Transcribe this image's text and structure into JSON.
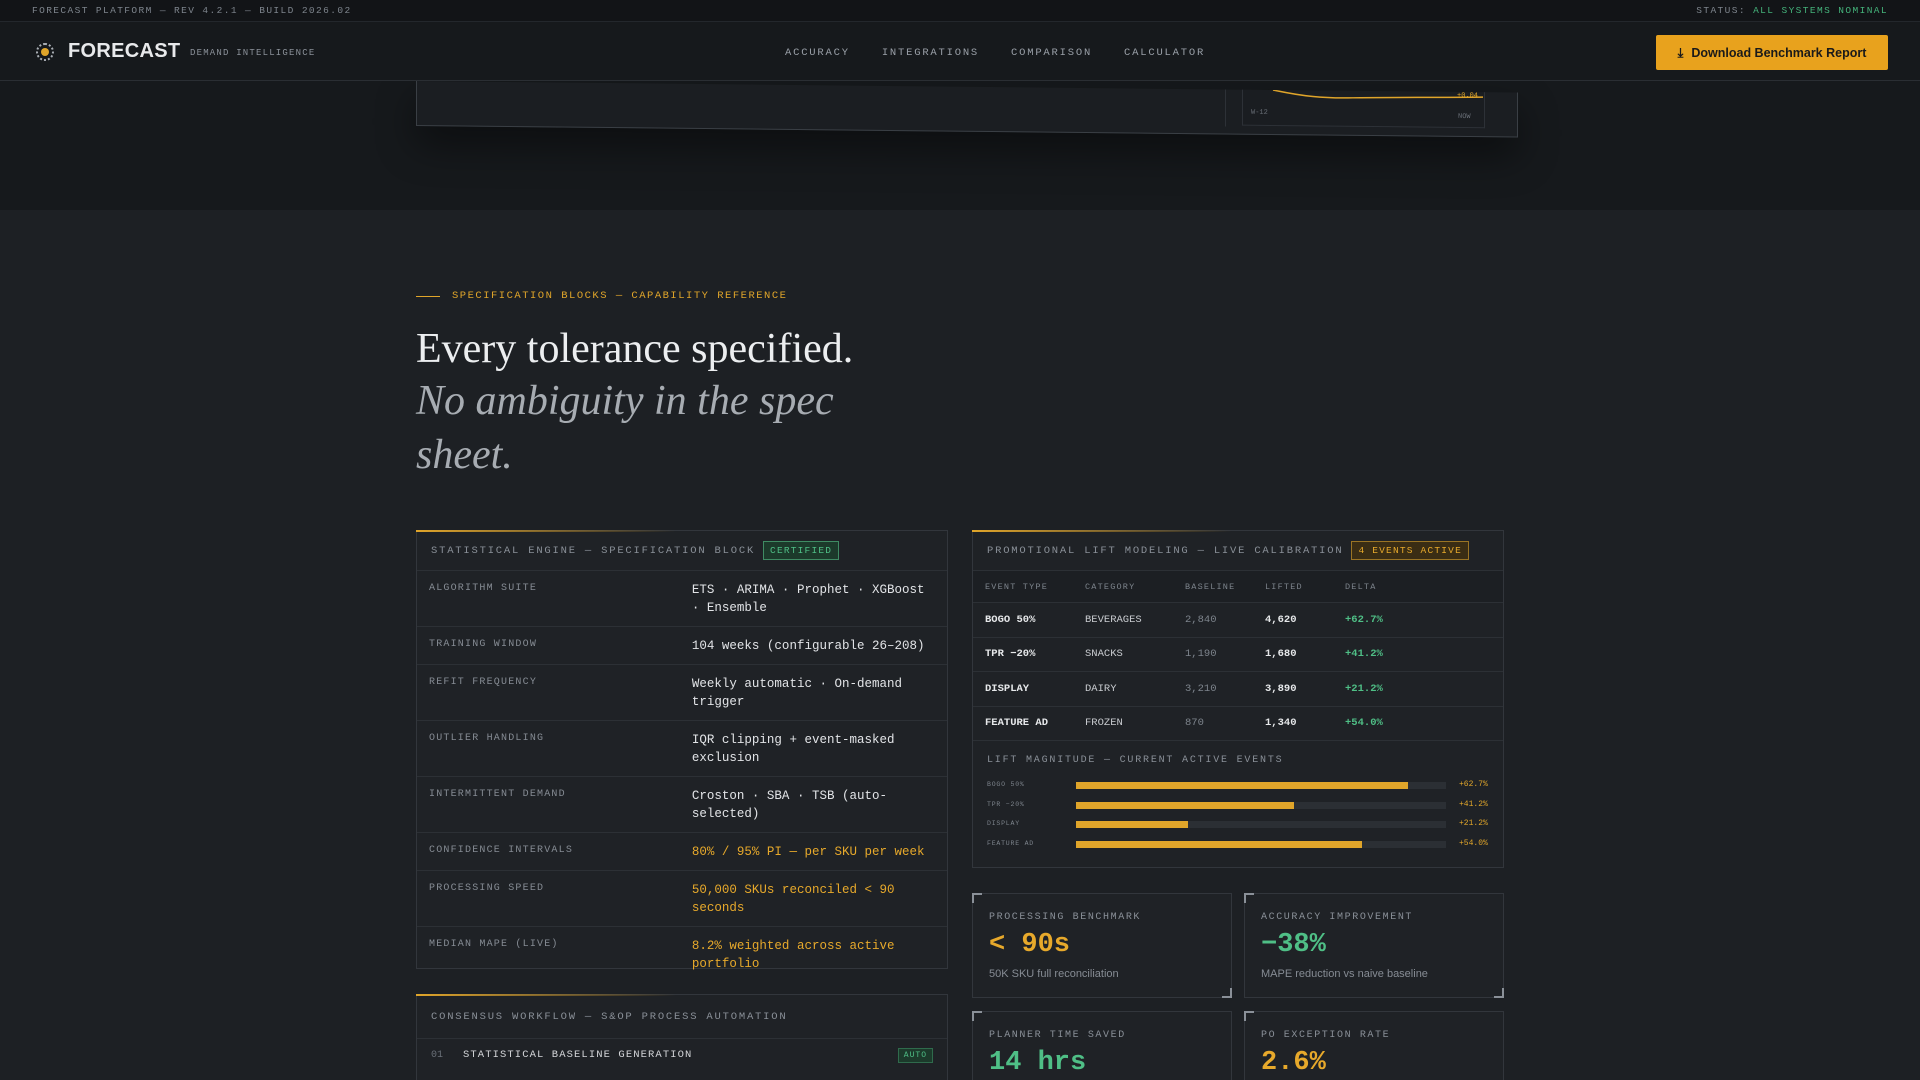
{
  "topbar": {
    "left": "FORECAST PLATFORM — REV 4.2.1 — BUILD 2026.02",
    "status_label": "STATUS:",
    "status_value": "ALL SYSTEMS NOMINAL"
  },
  "nav": {
    "brand": "FORECAST",
    "brand_sub": "DEMAND INTELLIGENCE",
    "links": [
      "ACCURACY",
      "INTEGRATIONS",
      "COMPARISON",
      "CALCULATOR"
    ],
    "cta": "Download Benchmark Report",
    "cta_icon": "download-icon"
  },
  "hero_preview": {
    "x_start": "W-12",
    "x_end": "NOW",
    "delta": "+0.04"
  },
  "section": {
    "eyebrow": "SPECIFICATION BLOCKS — CAPABILITY REFERENCE",
    "title": "Every tolerance specified.",
    "subtitle": "No ambiguity in the spec sheet."
  },
  "spec_block": {
    "title": "STATISTICAL ENGINE — SPECIFICATION BLOCK",
    "badge": "CERTIFIED",
    "rows": [
      {
        "key": "ALGORITHM SUITE",
        "value": "ETS · ARIMA · Prophet · XGBoost · Ensemble",
        "highlight": false
      },
      {
        "key": "TRAINING WINDOW",
        "value": "104 weeks (configurable 26–208)",
        "highlight": false
      },
      {
        "key": "REFIT FREQUENCY",
        "value": "Weekly automatic · On-demand trigger",
        "highlight": false
      },
      {
        "key": "OUTLIER HANDLING",
        "value": "IQR clipping + event-masked exclusion",
        "highlight": false
      },
      {
        "key": "INTERMITTENT DEMAND",
        "value": "Croston · SBA · TSB (auto-selected)",
        "highlight": false
      },
      {
        "key": "CONFIDENCE INTERVALS",
        "value": "80% / 95% PI — per SKU per week",
        "highlight": true
      },
      {
        "key": "PROCESSING SPEED",
        "value": "50,000 SKUs reconciled < 90 seconds",
        "highlight": true
      },
      {
        "key": "MEDIAN MAPE (LIVE)",
        "value": "8.2% weighted across active portfolio",
        "highlight": true
      }
    ]
  },
  "workflow": {
    "title": "CONSENSUS WORKFLOW — S&OP PROCESS AUTOMATION",
    "steps": [
      {
        "num": "01",
        "label": "STATISTICAL BASELINE GENERATION",
        "tag": "AUTO"
      }
    ]
  },
  "promo": {
    "title": "PROMOTIONAL LIFT MODELING — LIVE CALIBRATION",
    "badge": "4 EVENTS ACTIVE",
    "columns": [
      "EVENT TYPE",
      "CATEGORY",
      "BASELINE",
      "LIFTED",
      "DELTA"
    ],
    "rows": [
      [
        "BOGO 50%",
        "BEVERAGES",
        "2,840",
        "4,620",
        "+62.7%"
      ],
      [
        "TPR −20%",
        "SNACKS",
        "1,190",
        "1,680",
        "+41.2%"
      ],
      [
        "DISPLAY",
        "DAIRY",
        "3,210",
        "3,890",
        "+21.2%"
      ],
      [
        "FEATURE AD",
        "FROZEN",
        "870",
        "1,340",
        "+54.0%"
      ]
    ],
    "lift_title": "LIFT MAGNITUDE — CURRENT ACTIVE EVENTS",
    "lift_bars": [
      {
        "label": "BOGO 50%",
        "pct": 0.897,
        "value": "+62.7%"
      },
      {
        "label": "TPR −20%",
        "pct": 0.59,
        "value": "+41.2%"
      },
      {
        "label": "DISPLAY",
        "pct": 0.303,
        "value": "+21.2%"
      },
      {
        "label": "FEATURE AD",
        "pct": 0.772,
        "value": "+54.0%"
      }
    ]
  },
  "metrics": [
    {
      "label": "PROCESSING BENCHMARK",
      "value": "< 90s",
      "sub": "50K SKU full reconciliation",
      "color": "#e7a92b"
    },
    {
      "label": "ACCURACY IMPROVEMENT",
      "value": "−38%",
      "sub": "MAPE reduction vs naive baseline",
      "color": "#4fbf86"
    },
    {
      "label": "PLANNER TIME SAVED",
      "value": "14 hrs",
      "sub": "",
      "color": "#4fbf86"
    },
    {
      "label": "PO EXCEPTION RATE",
      "value": "2.6%",
      "sub": "",
      "color": "#e7a92b"
    }
  ]
}
